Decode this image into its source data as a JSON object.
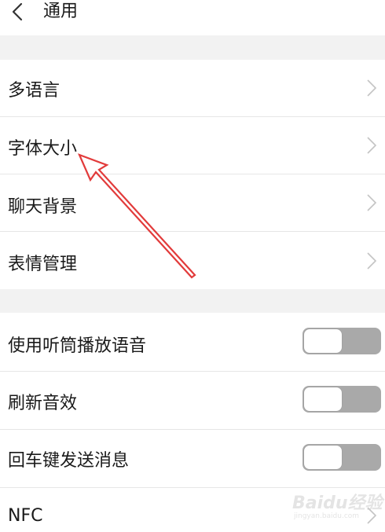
{
  "header": {
    "title": "通用"
  },
  "sections": [
    {
      "items": [
        {
          "label": "多语言",
          "control": "chevron-right-icon"
        },
        {
          "label": "字体大小",
          "control": "chevron-right-icon"
        },
        {
          "label": "聊天背景",
          "control": "chevron-right-icon"
        },
        {
          "label": "表情管理",
          "control": "chevron-right-icon"
        }
      ]
    },
    {
      "items": [
        {
          "label": "使用听筒播放语音",
          "control": "toggle",
          "checked": false
        },
        {
          "label": "刷新音效",
          "control": "toggle",
          "checked": false
        },
        {
          "label": "回车键发送消息",
          "control": "toggle",
          "checked": false
        },
        {
          "label": "NFC",
          "control": "chevron-right-icon"
        }
      ]
    }
  ],
  "annotation": {
    "type": "arrow",
    "color": "#e23b3b",
    "points_to": "字体大小"
  },
  "watermark": {
    "main": "Baidu经验",
    "sub": "jingyan.baidu.com"
  },
  "colors": {
    "background": "#ffffff",
    "section_gap": "#f2f2f2",
    "divider": "#e6e6e6",
    "text": "#1a1a1a",
    "chevron": "#c4c4c4",
    "toggle_track": "#a9a9a9",
    "toggle_knob": "#ffffff"
  }
}
